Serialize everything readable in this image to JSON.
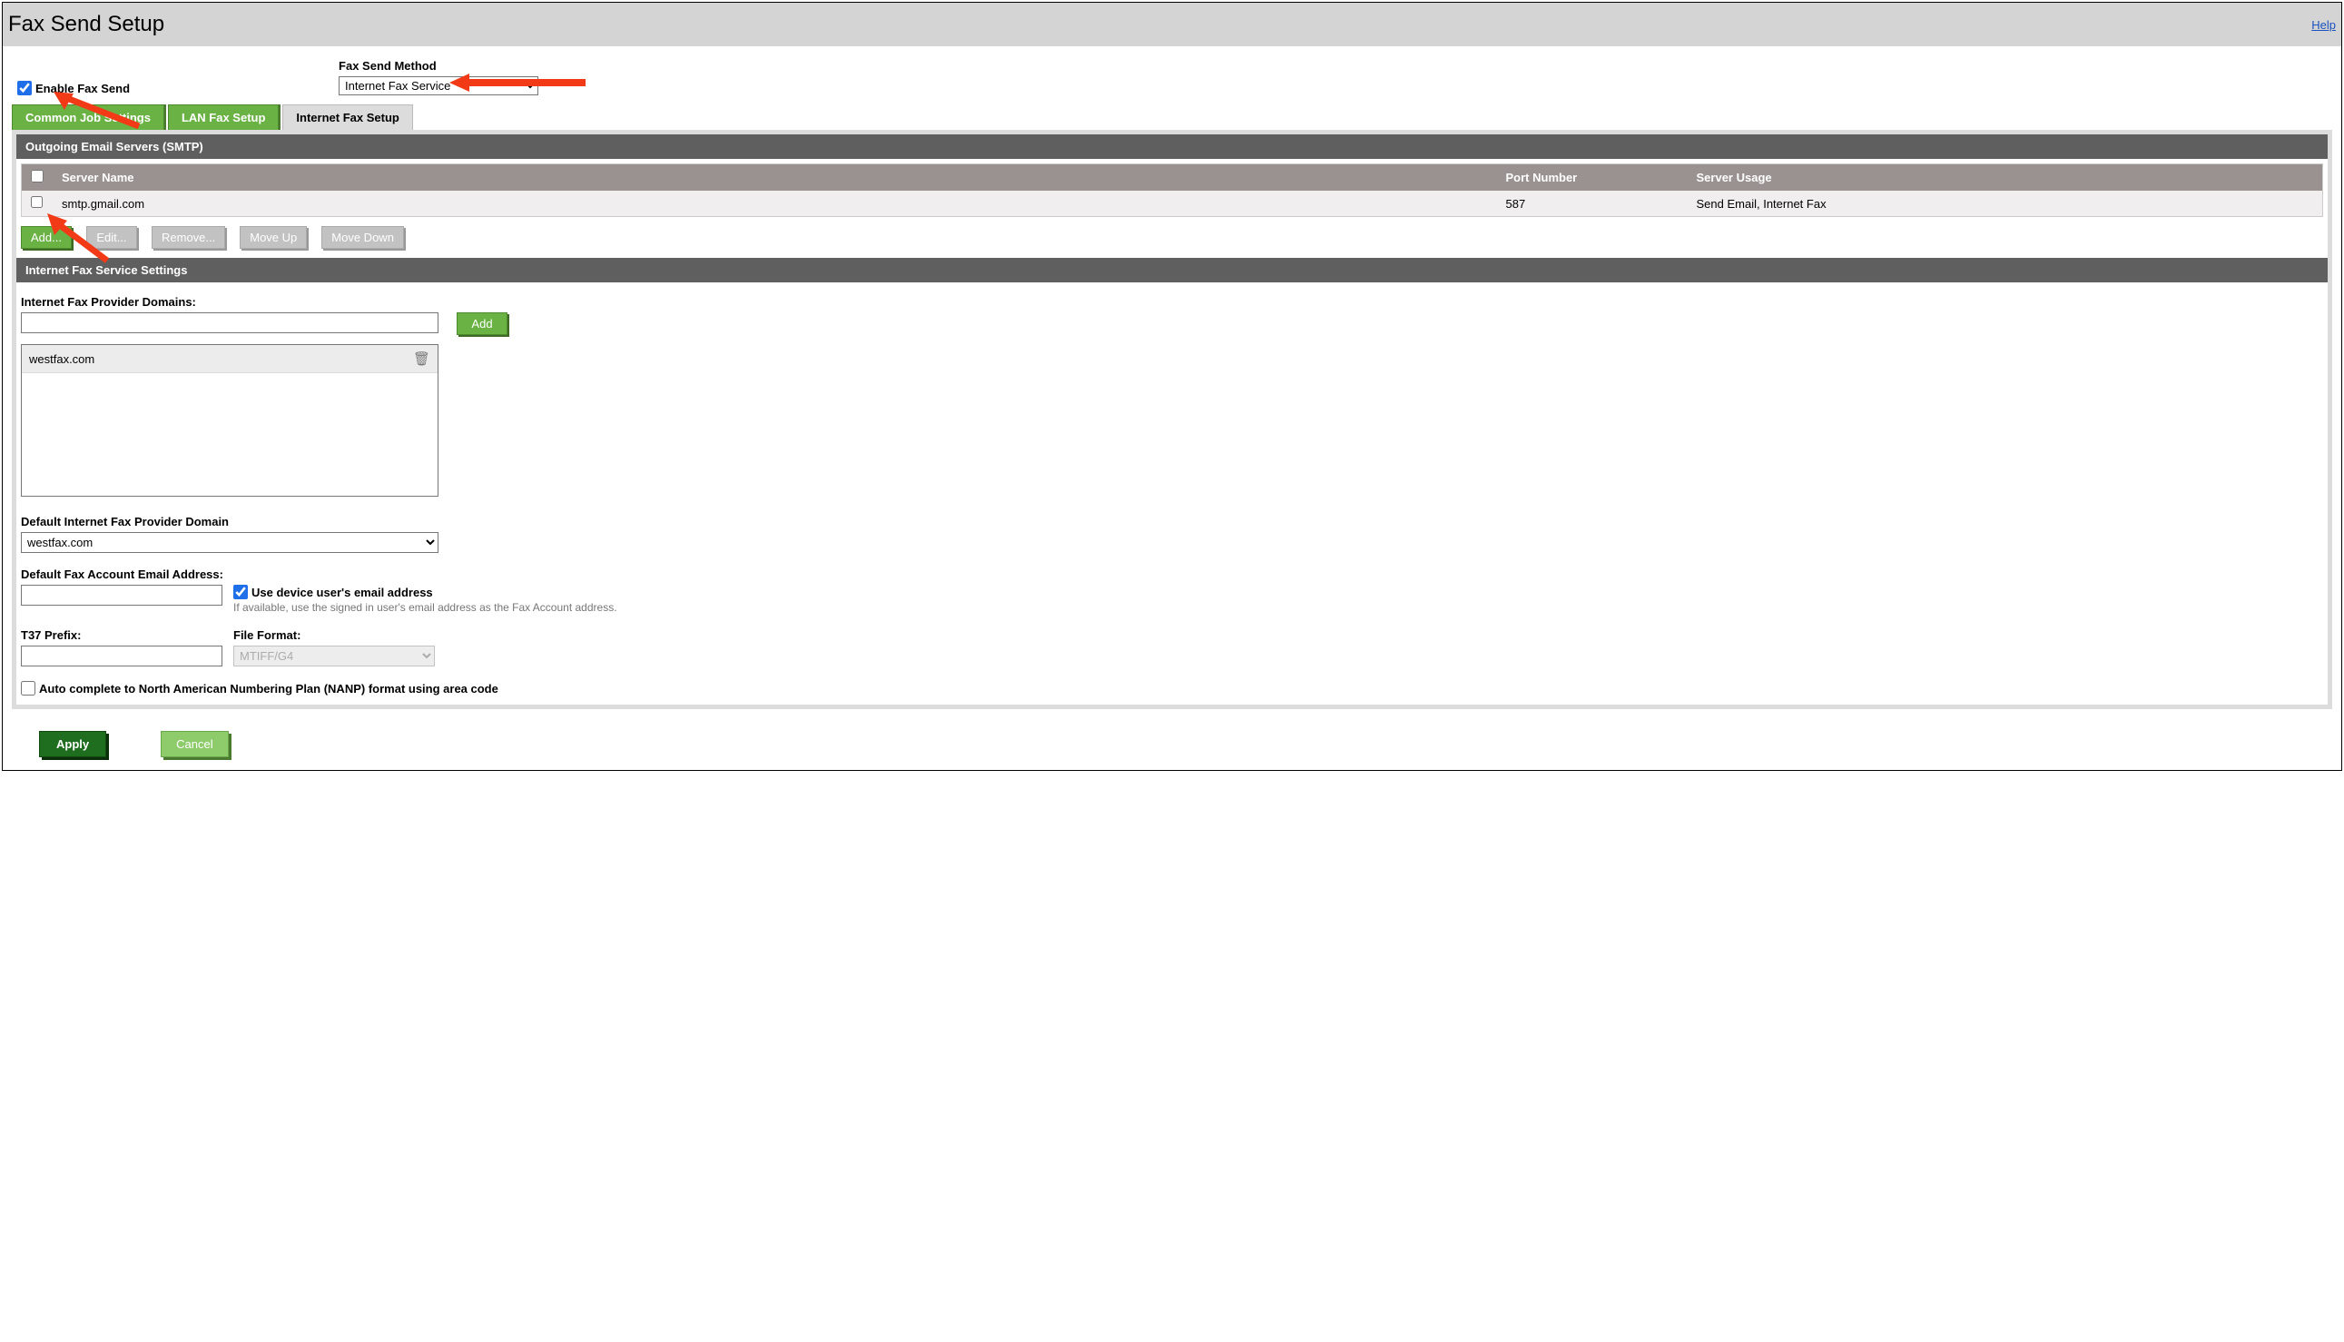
{
  "header": {
    "title": "Fax Send Setup",
    "help": "Help"
  },
  "enable": {
    "label": "Enable Fax Send",
    "checked": true
  },
  "method": {
    "label": "Fax Send Method",
    "selected": "Internet Fax Service"
  },
  "tabs": {
    "common": "Common Job Settings",
    "lan": "LAN Fax Setup",
    "internet": "Internet Fax Setup"
  },
  "smtp": {
    "header": "Outgoing Email Servers (SMTP)",
    "cols": {
      "name": "Server Name",
      "port": "Port Number",
      "usage": "Server Usage"
    },
    "row": {
      "name": "smtp.gmail.com",
      "port": "587",
      "usage": "Send Email, Internet Fax"
    },
    "buttons": {
      "add": "Add...",
      "edit": "Edit...",
      "remove": "Remove...",
      "moveup": "Move Up",
      "movedown": "Move Down"
    }
  },
  "settings": {
    "header": "Internet Fax Service Settings",
    "domainsLabel": "Internet Fax Provider Domains:",
    "addBtn": "Add",
    "domainItem": "westfax.com",
    "defaultDomainLabel": "Default Internet Fax Provider Domain",
    "defaultDomainValue": "westfax.com",
    "emailLabel": "Default Fax Account Email Address:",
    "useDeviceLabel": "Use device user's email address",
    "useDeviceHint": "If available, use the signed in user's email address as the Fax Account address.",
    "t37Label": "T37 Prefix:",
    "formatLabel": "File Format:",
    "formatValue": "MTIFF/G4",
    "nanpLabel": "Auto complete to North American Numbering Plan (NANP) format using area code"
  },
  "footer": {
    "apply": "Apply",
    "cancel": "Cancel"
  }
}
